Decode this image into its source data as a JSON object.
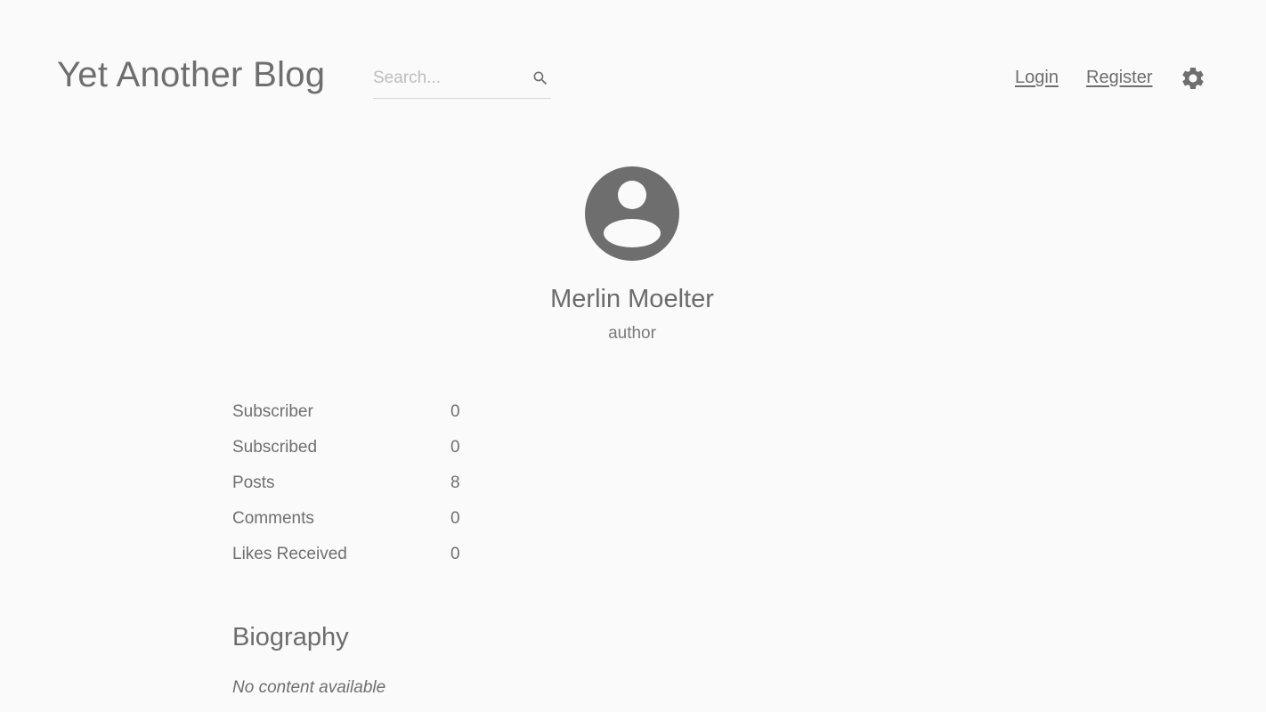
{
  "header": {
    "site_title": "Yet Another Blog",
    "search": {
      "placeholder": "Search...",
      "value": "",
      "icon": "search-icon"
    },
    "nav": {
      "login": "Login",
      "register": "Register"
    },
    "settings_icon": "gear-icon"
  },
  "profile": {
    "avatar_icon": "account-circle-icon",
    "name": "Merlin Moelter",
    "role": "author"
  },
  "stats": [
    {
      "label": "Subscriber",
      "value": "0"
    },
    {
      "label": "Subscribed",
      "value": "0"
    },
    {
      "label": "Posts",
      "value": "8"
    },
    {
      "label": "Comments",
      "value": "0"
    },
    {
      "label": "Likes Received",
      "value": "0"
    }
  ],
  "biography": {
    "title": "Biography",
    "content": "No content available"
  },
  "colors": {
    "background": "#fafafa",
    "text": "#6d6d6d",
    "icon": "#6e6e6e"
  }
}
